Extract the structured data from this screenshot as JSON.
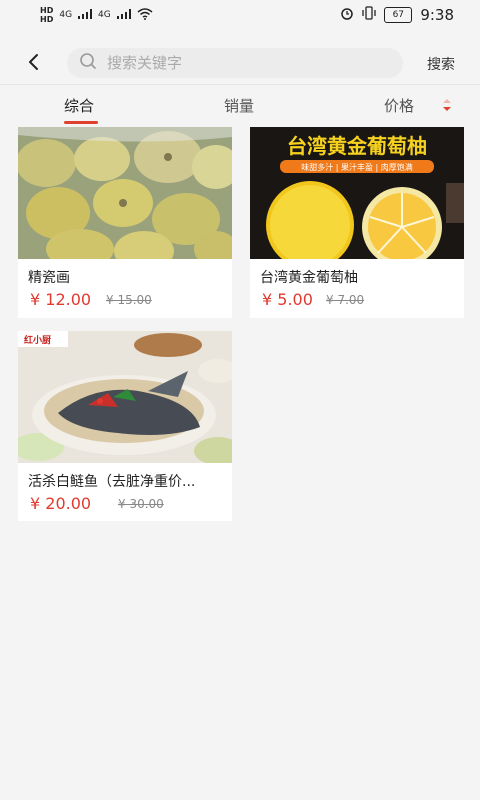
{
  "status": {
    "left_icons": [
      "hd-icon",
      "signal-icon",
      "signal-icon",
      "wifi-icon"
    ],
    "network_1": "4G",
    "network_2": "4G",
    "battery": "67",
    "time": "9:38"
  },
  "header": {
    "search_placeholder": "搜索关键字",
    "search_button": "搜索"
  },
  "tabs": [
    "综合",
    "销量",
    "价格"
  ],
  "colors": {
    "accent": "#e0412e",
    "price": "#e23a2e"
  },
  "products": [
    {
      "name": "精瓷画",
      "price": "¥ 12.00",
      "orig": "¥ 15.00"
    },
    {
      "name": "台湾黄金葡萄柚",
      "price": "¥ 5.00",
      "orig": "¥ 7.00",
      "banner": "台湾黄金葡萄柚",
      "tags": "味甜多汁 | 果汁丰盈 | 肉厚饱满"
    },
    {
      "name": "活杀白鲢鱼（去脏净重价...",
      "price": "¥ 20.00",
      "orig": "¥ 30.00",
      "logo": "红小厨"
    }
  ]
}
